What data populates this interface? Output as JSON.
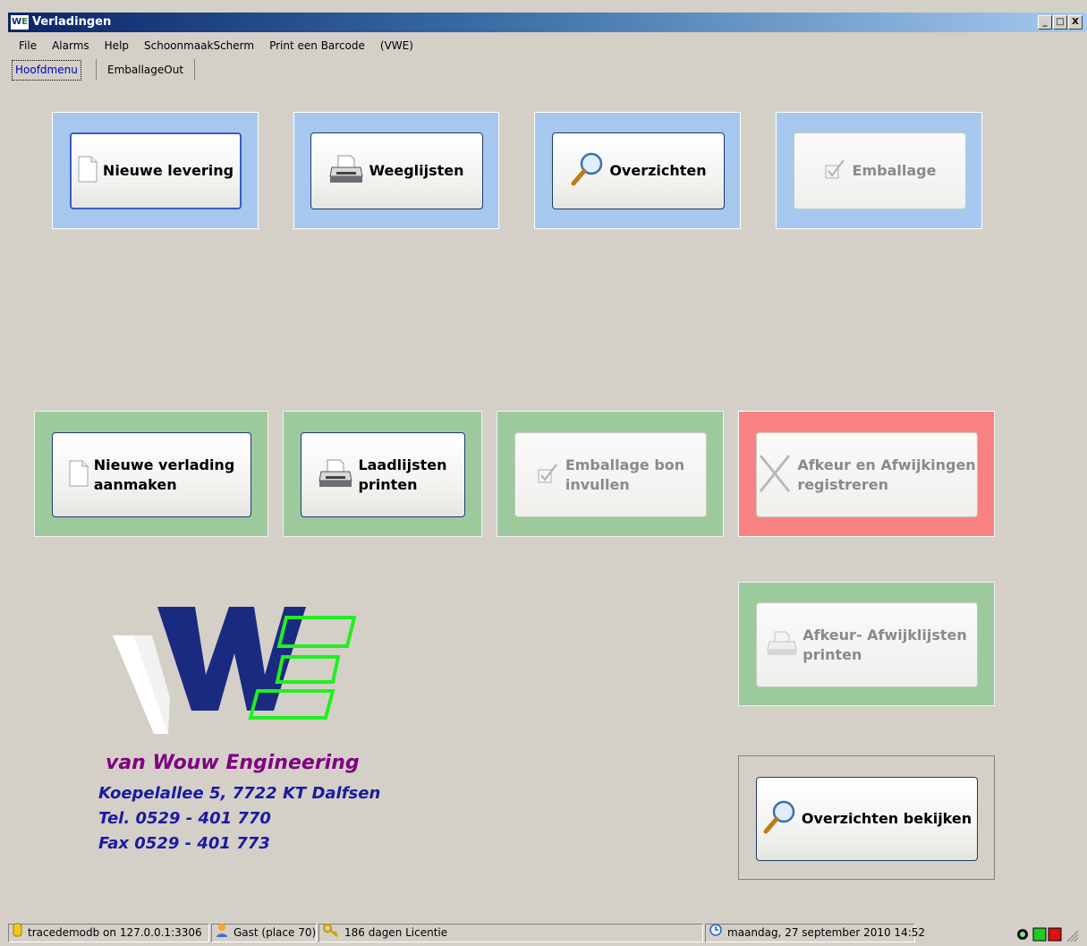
{
  "window": {
    "title": "Verladingen",
    "logo_w": "W",
    "logo_e": "E",
    "minimize": "_",
    "maximize": "□",
    "close": "X"
  },
  "menu": [
    "File",
    "Alarms",
    "Help",
    "SchoonmaakScherm",
    "Print een Barcode",
    "(VWE)"
  ],
  "tabs": {
    "active": "Hoofdmenu",
    "other": "EmballageOut"
  },
  "buttons": {
    "nieuwe_levering": "Nieuwe levering",
    "weeglijsten": "Weeglijsten",
    "overzichten": "Overzichten",
    "emballage": "Emballage",
    "nieuwe_verlading_l1": "Nieuwe verlading",
    "nieuwe_verlading_l2": "aanmaken",
    "laadlijsten_l1": "Laadlijsten",
    "laadlijsten_l2": "printen",
    "emballage_bon_l1": "Emballage bon",
    "emballage_bon_l2": "invullen",
    "afkeur_l1": "Afkeur en Afwijkingen",
    "afkeur_l2": "registreren",
    "afkeur_print_l1": "Afkeur- Afwijklijsten",
    "afkeur_print_l2": "printen",
    "overzichten_bekijken": "Overzichten bekijken"
  },
  "company": {
    "name": "van Wouw Engineering",
    "address": "Koepelallee 5, 7722 KT  Dalfsen",
    "tel": "Tel.  0529 - 401 770",
    "fax": "Fax  0529 - 401 773"
  },
  "status": {
    "db": "tracedemodb on 127.0.0.1:3306",
    "user": "Gast (place 70)",
    "license": "186 dagen Licentie",
    "datetime": "maandag, 27 september 2010 14:52"
  },
  "colors": {
    "blue_panel": "#a6c8ee",
    "green_panel": "#9dca9d",
    "red_panel": "#f88282"
  }
}
